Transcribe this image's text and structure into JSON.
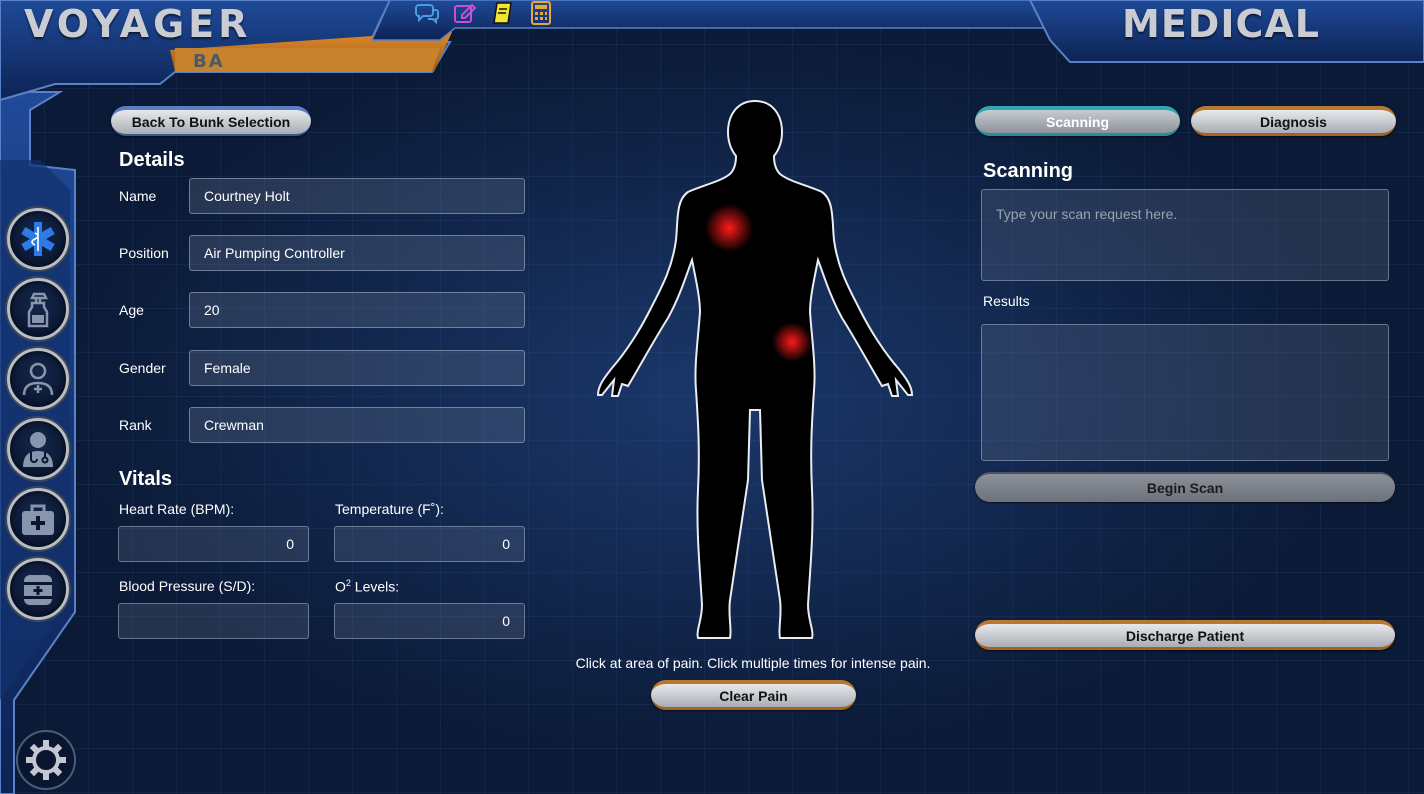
{
  "header": {
    "brand": "VOYAGER",
    "station": "BA",
    "section": "MEDICAL"
  },
  "top_icons": [
    "chat-icon",
    "edit-icon",
    "notes-icon",
    "calculator-icon"
  ],
  "side_nav": [
    "medical-star-icon",
    "spray-bottle-icon",
    "patient-add-icon",
    "doctor-icon",
    "first-aid-kit-icon",
    "medical-canister-icon",
    "settings-icon"
  ],
  "back_button": "Back To Bunk Selection",
  "details": {
    "title": "Details",
    "fields": [
      {
        "label": "Name",
        "value": "Courtney Holt"
      },
      {
        "label": "Position",
        "value": "Air Pumping Controller"
      },
      {
        "label": "Age",
        "value": "20"
      },
      {
        "label": "Gender",
        "value": "Female"
      },
      {
        "label": "Rank",
        "value": "Crewman"
      }
    ]
  },
  "vitals": {
    "title": "Vitals",
    "heart_rate": {
      "label": "Heart Rate (BPM):",
      "value": "0"
    },
    "temperature": {
      "label": "Temperature (F˚):",
      "value": "0"
    },
    "blood_pressure": {
      "label": "Blood Pressure (S/D):",
      "value": ""
    },
    "o2": {
      "label": "O",
      "sup": "2",
      "label_rest": " Levels:",
      "value": "0"
    }
  },
  "body": {
    "hint": "Click at area of pain. Click multiple times for intense pain.",
    "clear_label": "Clear Pain",
    "pain_color": "#ff1a1a"
  },
  "tabs": {
    "scanning": "Scanning",
    "diagnosis": "Diagnosis"
  },
  "scanning": {
    "title": "Scanning",
    "placeholder": "Type your scan request here.",
    "results_label": "Results",
    "results_value": "",
    "begin_label": "Begin Scan"
  },
  "discharge_label": "Discharge Patient",
  "colors": {
    "accent_orange": "#b9782f",
    "accent_teal": "#31a7b2",
    "accent_blue": "#5d7dc2",
    "frame_blue": "#1b3b7a"
  }
}
